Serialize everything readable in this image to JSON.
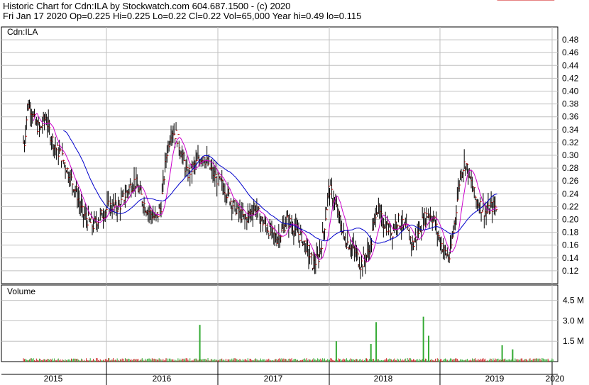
{
  "header": {
    "line1": "Historic Chart for Cdn:ILA by Stockwatch.com 604.687.1500 - (c) 2020",
    "line2": "Fri Jan 17 2020   Op=0.225  Hi=0.225  Lo=0.22  Cl=0.22  Vol=65,000  Year hi=0.49  lo=0.115"
  },
  "colors": {
    "background": "#ffffff",
    "grid": "#c0c0c0",
    "price_bar": "#000000",
    "price_close_tick": "#cc0000",
    "ma_short": "#cc00cc",
    "ma_long": "#0000cc",
    "volume_up": "#33aa33",
    "volume_down": "#cc2222"
  },
  "chart_data": [
    {
      "type": "ohlc",
      "title": "Cdn:ILA",
      "ylim": [
        0.1,
        0.5
      ],
      "yticks": [
        "0.48",
        "0.46",
        "0.44",
        "0.42",
        "0.40",
        "0.38",
        "0.36",
        "0.34",
        "0.32",
        "0.30",
        "0.28",
        "0.26",
        "0.24",
        "0.22",
        "0.20",
        "0.18",
        "0.16",
        "0.14",
        "0.12"
      ],
      "x_labels": [
        "2015",
        "2016",
        "2017",
        "2018",
        "2019",
        "2020"
      ],
      "grid": true,
      "series": [
        {
          "name": "price",
          "x": [
            2015.0,
            2015.03,
            2015.07,
            2015.1,
            2015.15,
            2015.2,
            2015.25,
            2015.3,
            2015.35,
            2015.4,
            2015.45,
            2015.5,
            2015.55,
            2015.6,
            2015.65,
            2015.7,
            2015.75,
            2015.8,
            2015.9,
            2016.0,
            2016.05,
            2016.1,
            2016.15,
            2016.2,
            2016.25,
            2016.3,
            2016.35,
            2016.4,
            2016.45,
            2016.5,
            2016.55,
            2016.6,
            2016.65,
            2016.7,
            2016.8,
            2016.9,
            2017.0,
            2017.05,
            2017.1,
            2017.15,
            2017.2,
            2017.25,
            2017.3,
            2017.35,
            2017.4,
            2017.45,
            2017.5,
            2017.55,
            2017.6,
            2017.65,
            2017.7,
            2017.75,
            2017.8,
            2017.85,
            2017.9,
            2017.95,
            2018.0,
            2018.05,
            2018.1,
            2018.15,
            2018.2,
            2018.25,
            2018.3,
            2018.35,
            2018.4,
            2018.45,
            2018.5,
            2018.55,
            2018.6,
            2018.65,
            2018.7,
            2018.75,
            2018.8,
            2018.85,
            2018.9,
            2018.95,
            2019.0,
            2019.05,
            2019.1,
            2019.15,
            2019.2,
            2019.25,
            2019.3,
            2019.35,
            2019.4,
            2019.45,
            2019.5,
            2019.55,
            2019.6,
            2019.65,
            2019.7,
            2019.75,
            2019.8,
            2019.85,
            2019.9,
            2019.95,
            2020.0,
            2020.04
          ],
          "close": [
            0.32,
            0.38,
            0.37,
            0.35,
            0.34,
            0.36,
            0.33,
            0.31,
            0.3,
            0.28,
            0.26,
            0.24,
            0.21,
            0.2,
            0.19,
            0.2,
            0.21,
            0.22,
            0.22,
            0.25,
            0.26,
            0.24,
            0.22,
            0.21,
            0.2,
            0.22,
            0.3,
            0.34,
            0.33,
            0.3,
            0.27,
            0.28,
            0.29,
            0.3,
            0.27,
            0.25,
            0.22,
            0.21,
            0.2,
            0.21,
            0.22,
            0.2,
            0.19,
            0.18,
            0.17,
            0.18,
            0.2,
            0.19,
            0.18,
            0.17,
            0.15,
            0.13,
            0.14,
            0.18,
            0.25,
            0.23,
            0.2,
            0.17,
            0.16,
            0.15,
            0.13,
            0.14,
            0.16,
            0.22,
            0.2,
            0.19,
            0.18,
            0.2,
            0.19,
            0.18,
            0.16,
            0.18,
            0.2,
            0.21,
            0.2,
            0.17,
            0.15,
            0.14,
            0.2,
            0.27,
            0.29,
            0.26,
            0.23,
            0.22,
            0.21,
            0.22,
            0.22
          ]
        },
        {
          "name": "ma_short"
        },
        {
          "name": "ma_long"
        }
      ]
    },
    {
      "type": "bar",
      "title": "Volume",
      "ylim": [
        0,
        5000000
      ],
      "yticks": [
        "4.5 M",
        "3.0 M",
        "1.5 M"
      ],
      "spikes": [
        {
          "x": 2016.67,
          "value": 2700000
        },
        {
          "x": 2017.97,
          "value": 1500000
        },
        {
          "x": 2018.35,
          "value": 2900000
        },
        {
          "x": 2018.3,
          "value": 1300000
        },
        {
          "x": 2018.8,
          "value": 3300000
        },
        {
          "x": 2018.85,
          "value": 1900000
        },
        {
          "x": 2019.55,
          "value": 1200000
        },
        {
          "x": 2019.65,
          "value": 900000
        }
      ]
    }
  ]
}
